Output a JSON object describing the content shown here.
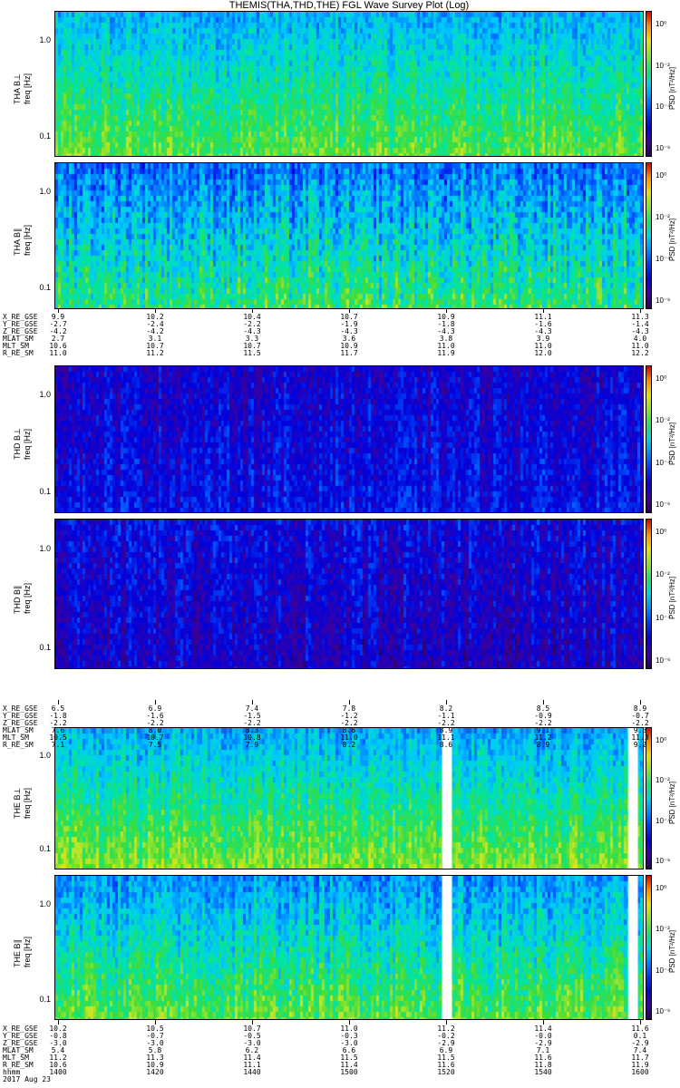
{
  "title": "THEMIS(THA,THD,THE) FGL Wave Survey Plot (Log)",
  "colorbar": {
    "label": "PSD [nT²/Hz]",
    "ticks": [
      "10⁰",
      "10⁻²",
      "10⁻⁴",
      "10⁻⁶"
    ]
  },
  "chart_data": {
    "type": "heatmap",
    "yscale": "log",
    "ylim_hz": [
      0.06,
      2.0
    ],
    "ytick_labels": [
      "1.0",
      "0.1"
    ],
    "color_scale": "rainbow (violet→blue→cyan→green→yellow→red), log PSD",
    "color_range_log10": [
      -7,
      1
    ],
    "panels": [
      {
        "name": "THA B⊥",
        "ylabel": [
          "THA B⊥",
          "freq [Hz]"
        ],
        "dominant_level_log10": -2.3,
        "variability": 0.9,
        "low_freq_boost": 0.8,
        "gaps": []
      },
      {
        "name": "THA B∥",
        "ylabel": [
          "THA B∥",
          "freq [Hz]"
        ],
        "dominant_level_log10": -2.8,
        "variability": 1.2,
        "low_freq_boost": 0.9,
        "gaps": []
      },
      {
        "name": "THD B⊥",
        "ylabel": [
          "THD B⊥",
          "freq [Hz]"
        ],
        "dominant_level_log10": -5.0,
        "variability": 1.0,
        "low_freq_boost": 0.0,
        "gaps": []
      },
      {
        "name": "THD B∥",
        "ylabel": [
          "THD B∥",
          "freq [Hz]"
        ],
        "dominant_level_log10": -5.2,
        "variability": 1.1,
        "low_freq_boost": -0.6,
        "gaps": []
      },
      {
        "name": "THE B⊥",
        "ylabel": [
          "THE B⊥",
          "freq [Hz]"
        ],
        "dominant_level_log10": -2.2,
        "variability": 0.9,
        "low_freq_boost": 1.0,
        "gaps": [
          [
            1519,
            1521
          ],
          [
            1557,
            1559
          ]
        ]
      },
      {
        "name": "THE B∥",
        "ylabel": [
          "THE B∥",
          "freq [Hz]"
        ],
        "dominant_level_log10": -2.4,
        "variability": 1.0,
        "low_freq_boost": 1.0,
        "gaps": [
          [
            1519,
            1521
          ],
          [
            1557,
            1559
          ]
        ]
      }
    ],
    "x_time_hhmm": [
      1400,
      1420,
      1440,
      1500,
      1520,
      1540,
      1600
    ],
    "date": "2017 Aug 23"
  },
  "ephemeris": [
    {
      "rows": [
        {
          "name": "X_RE_GSE",
          "values": [
            "9.9",
            "10.2",
            "10.4",
            "10.7",
            "10.9",
            "11.1",
            "11.3"
          ]
        },
        {
          "name": "Y_RE_GSE",
          "values": [
            "-2.7",
            "-2.4",
            "-2.2",
            "-1.9",
            "-1.8",
            "-1.6",
            "-1.4"
          ]
        },
        {
          "name": "Z_RE_GSE",
          "values": [
            "-4.2",
            "-4.2",
            "-4.3",
            "-4.3",
            "-4.3",
            "-4.3",
            "-4.3"
          ]
        },
        {
          "name": "MLAT_SM",
          "values": [
            "2.7",
            "3.1",
            "3.3",
            "3.6",
            "3.8",
            "3.9",
            "4.0"
          ]
        },
        {
          "name": "MLT_SM",
          "values": [
            "10.6",
            "10.7",
            "10.7",
            "10.9",
            "11.0",
            "11.0",
            "11.0"
          ]
        },
        {
          "name": "R_RE_SM",
          "values": [
            "11.0",
            "11.2",
            "11.5",
            "11.7",
            "11.9",
            "12.0",
            "12.2"
          ]
        }
      ]
    },
    {
      "rows": [
        {
          "name": "X_RE_GSE",
          "values": [
            "6.5",
            "6.9",
            "7.4",
            "7.8",
            "8.2",
            "8.5",
            "8.9"
          ]
        },
        {
          "name": "Y_RE_GSE",
          "values": [
            "-1.8",
            "-1.6",
            "-1.5",
            "-1.2",
            "-1.1",
            "-0.9",
            "-0.7"
          ]
        },
        {
          "name": "Z_RE_GSE",
          "values": [
            "-2.2",
            "-2.2",
            "-2.2",
            "-2.2",
            "-2.2",
            "-2.2",
            "-2.2"
          ]
        },
        {
          "name": "MLAT_SM",
          "values": [
            "7.6",
            "8.0",
            "8.3",
            "8.6",
            "8.9",
            "9.1",
            "9.3"
          ]
        },
        {
          "name": "MLT_SM",
          "values": [
            "10.5",
            "10.7",
            "10.8",
            "11.0",
            "11.1",
            "11.2",
            "11.3"
          ]
        },
        {
          "name": "R_RE_SM",
          "values": [
            "7.1",
            "7.5",
            "7.9",
            "8.2",
            "8.6",
            "8.9",
            "9.2"
          ]
        }
      ]
    },
    {
      "rows": [
        {
          "name": "X_RE_GSE",
          "values": [
            "10.2",
            "10.5",
            "10.7",
            "11.0",
            "11.2",
            "11.4",
            "11.6"
          ]
        },
        {
          "name": "Y_RE_GSE",
          "values": [
            "-0.8",
            "-0.7",
            "-0.5",
            "-0.3",
            "-0.2",
            "-0.0",
            "0.1"
          ]
        },
        {
          "name": "Z_RE_GSE",
          "values": [
            "-3.0",
            "-3.0",
            "-3.0",
            "-3.0",
            "-2.9",
            "-2.9",
            "-2.9"
          ]
        },
        {
          "name": "MLAT_SM",
          "values": [
            "5.4",
            "5.8",
            "6.2",
            "6.6",
            "6.9",
            "7.1",
            "7.4"
          ]
        },
        {
          "name": "MLT_SM",
          "values": [
            "11.2",
            "11.3",
            "11.4",
            "11.5",
            "11.5",
            "11.6",
            "11.7"
          ]
        },
        {
          "name": "R_RE_SM",
          "values": [
            "10.6",
            "10.9",
            "11.1",
            "11.4",
            "11.6",
            "11.8",
            "11.9"
          ]
        },
        {
          "name": "hhmm",
          "values": [
            "1400",
            "1420",
            "1440",
            "1500",
            "1520",
            "1540",
            "1600"
          ]
        }
      ]
    }
  ],
  "footer_date": "2017 Aug 23"
}
